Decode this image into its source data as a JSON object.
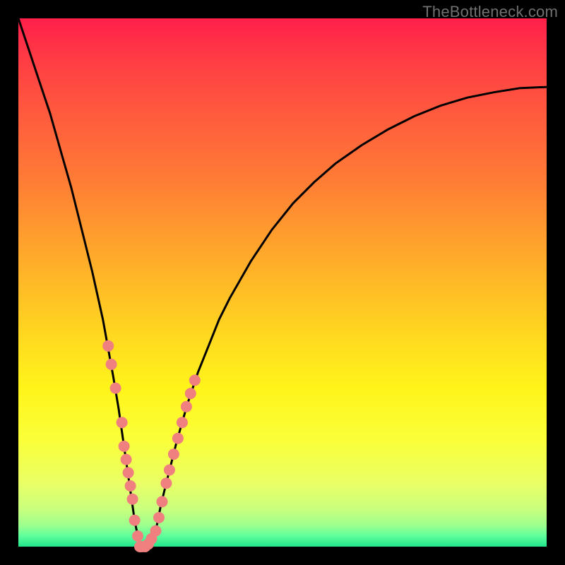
{
  "watermark": "TheBottleneck.com",
  "colors": {
    "frame": "#000000",
    "curve": "#000000",
    "overlay_dot": "#f08080",
    "gradient_top": "#ff1f4a",
    "gradient_bottom": "#22e48b"
  },
  "chart_data": {
    "type": "line",
    "title": "",
    "xlabel": "",
    "ylabel": "",
    "xlim": [
      0,
      100
    ],
    "ylim": [
      0,
      100
    ],
    "grid": false,
    "legend": false,
    "series": [
      {
        "name": "bottleneck-curve",
        "x": [
          0,
          2,
          4,
          6,
          8,
          10,
          12,
          14,
          16,
          18,
          19,
          20,
          21,
          22,
          23,
          24,
          25,
          26,
          27,
          28,
          30,
          32,
          34,
          36,
          38,
          40,
          44,
          48,
          52,
          56,
          60,
          65,
          70,
          75,
          80,
          85,
          90,
          95,
          100
        ],
        "y": [
          100,
          94,
          88,
          82,
          75,
          68,
          60,
          52,
          43,
          32,
          26,
          19,
          12,
          5,
          0,
          0,
          0,
          3,
          8,
          12,
          20,
          27,
          33,
          38,
          43,
          47,
          54,
          60,
          65,
          69,
          72.5,
          76,
          79,
          81.5,
          83.5,
          85,
          86,
          86.8,
          87
        ]
      }
    ],
    "overlay_points": {
      "name": "highlighted-segment",
      "x": [
        17.0,
        17.6,
        18.4,
        19.6,
        20.0,
        20.4,
        20.8,
        21.2,
        21.6,
        22.0,
        22.6,
        23.0,
        23.4,
        24.0,
        24.6,
        25.2,
        26.0,
        26.6,
        27.2,
        28.0,
        28.6,
        29.4,
        30.2,
        31.0,
        31.8,
        32.6,
        33.4
      ],
      "y": [
        38.0,
        34.5,
        30.0,
        23.5,
        19.0,
        16.5,
        14.0,
        11.5,
        9.0,
        5.0,
        2.0,
        0.0,
        0.0,
        0.0,
        0.5,
        1.5,
        3.0,
        5.5,
        8.5,
        12.0,
        14.5,
        17.5,
        20.5,
        23.5,
        26.5,
        29.0,
        31.5
      ]
    }
  }
}
